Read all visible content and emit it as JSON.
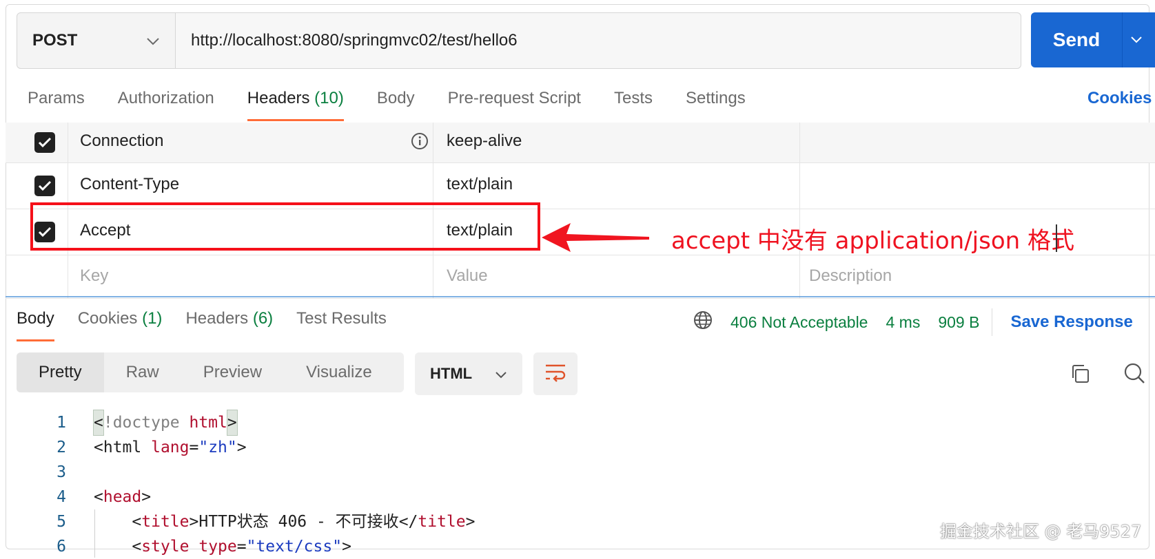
{
  "request": {
    "method": "POST",
    "url": "http://localhost:8080/springmvc02/test/hello6",
    "send_label": "Send"
  },
  "request_tabs": [
    {
      "label": "Params"
    },
    {
      "label": "Authorization"
    },
    {
      "label": "Headers",
      "count": "(10)"
    },
    {
      "label": "Body"
    },
    {
      "label": "Pre-request Script"
    },
    {
      "label": "Tests"
    },
    {
      "label": "Settings"
    }
  ],
  "cookies_link": "Cookies",
  "headers": [
    {
      "key": "Connection",
      "value": "keep-alive",
      "checked": true
    },
    {
      "key": "Content-Type",
      "value": "text/plain",
      "checked": true
    },
    {
      "key": "Accept",
      "value": "text/plain",
      "checked": true
    }
  ],
  "new_row": {
    "key": "Key",
    "value": "Value",
    "description": "Description"
  },
  "annotation": "accept 中没有 application/json 格式",
  "response_tabs": [
    {
      "label": "Body"
    },
    {
      "label": "Cookies",
      "count": "(1)"
    },
    {
      "label": "Headers",
      "count": "(6)"
    },
    {
      "label": "Test Results"
    }
  ],
  "response_status": {
    "status": "406 Not Acceptable",
    "time": "4 ms",
    "size": "909 B",
    "save_label": "Save Response"
  },
  "view_modes": [
    "Pretty",
    "Raw",
    "Preview",
    "Visualize"
  ],
  "format": "HTML",
  "code_lines": {
    "l1": {
      "num": "1"
    },
    "l2": {
      "num": "2"
    },
    "l3": {
      "num": "3"
    },
    "l4": {
      "num": "4"
    },
    "l5": {
      "num": "5",
      "title_text": "HTTP状态 406 - 不可接收"
    },
    "l6": {
      "num": "6"
    }
  },
  "watermark": "掘金技术社区 @ 老马9527",
  "colors": {
    "accent": "#ff6c37",
    "primary": "#1967d2",
    "success": "#0a7f3f",
    "annotation": "#f5101a"
  }
}
